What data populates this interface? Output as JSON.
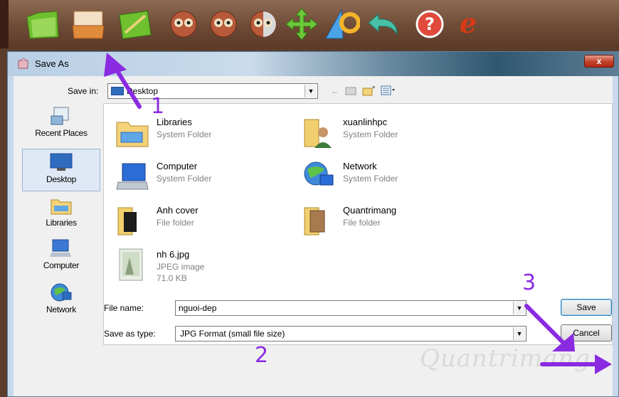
{
  "toolbar": {
    "icons": [
      "folder-icon",
      "open-icon",
      "edit-image-icon",
      "owl-icon",
      "owl-icon",
      "owl-half-icon",
      "move-arrows-icon",
      "effects-icon",
      "undo-icon",
      "help-icon",
      "ie-icon"
    ]
  },
  "dialog": {
    "title": "Save As",
    "close_label": "x",
    "save_in_label": "Save in:",
    "save_in_value": "Desktop",
    "places": [
      {
        "label": "Recent Places",
        "icon": "recent-places-icon"
      },
      {
        "label": "Desktop",
        "icon": "desktop-icon",
        "selected": true
      },
      {
        "label": "Libraries",
        "icon": "libraries-icon"
      },
      {
        "label": "Computer",
        "icon": "computer-icon"
      },
      {
        "label": "Network",
        "icon": "network-icon"
      }
    ],
    "files": [
      {
        "name": "Libraries",
        "type": "System Folder",
        "size": "",
        "icon": "libraries-folder-icon"
      },
      {
        "name": "xuanlinhpc",
        "type": "System Folder",
        "size": "",
        "icon": "user-folder-icon"
      },
      {
        "name": "Computer",
        "type": "System Folder",
        "size": "",
        "icon": "computer-icon"
      },
      {
        "name": "Network",
        "type": "System Folder",
        "size": "",
        "icon": "network-icon"
      },
      {
        "name": "Anh cover",
        "type": "File folder",
        "size": "",
        "icon": "folder-icon"
      },
      {
        "name": "Quantrimang",
        "type": "File folder",
        "size": "",
        "icon": "folder-icon"
      },
      {
        "name": "nh 6.jpg",
        "type": "JPEG image",
        "size": "71.0 KB",
        "icon": "image-file-icon"
      }
    ],
    "file_name_label": "File name:",
    "file_name_value": "nguoi-dep",
    "save_as_type_label": "Save as type:",
    "save_as_type_value": "JPG Format (small file size)",
    "save_button": "Save",
    "cancel_button": "Cancel"
  },
  "annotations": {
    "step1": "1",
    "step2": "2",
    "step3": "3"
  },
  "colors": {
    "annotation": "#8a2be2",
    "toolbar": "#6e4b36"
  }
}
